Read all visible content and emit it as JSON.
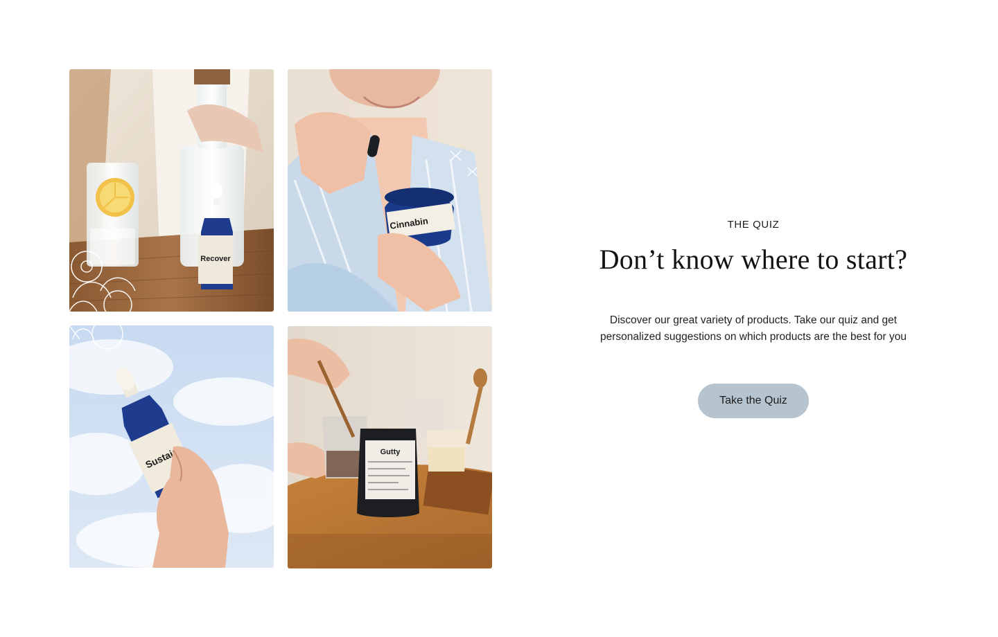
{
  "gallery": {
    "tiles": [
      {
        "name": "recover-tincture-photo",
        "bottle_label": "Recover"
      },
      {
        "name": "cinnabin-capsules-photo",
        "bottle_label": "Cinnabin"
      },
      {
        "name": "sustain-tincture-photo",
        "bottle_label": "Sustain"
      },
      {
        "name": "gutty-pouch-photo",
        "bottle_label": "Gutty"
      }
    ]
  },
  "quiz": {
    "eyebrow": "THE QUIZ",
    "headline": "Don’t know where to start?",
    "description": "Discover our great variety of products. Take our quiz and get personalized suggestions on which products are the best for you",
    "cta_label": "Take the Quiz"
  },
  "colors": {
    "cta_background": "#b5c4cf",
    "text": "#1b1b1b",
    "bottle_blue": "#1f3a8a"
  }
}
